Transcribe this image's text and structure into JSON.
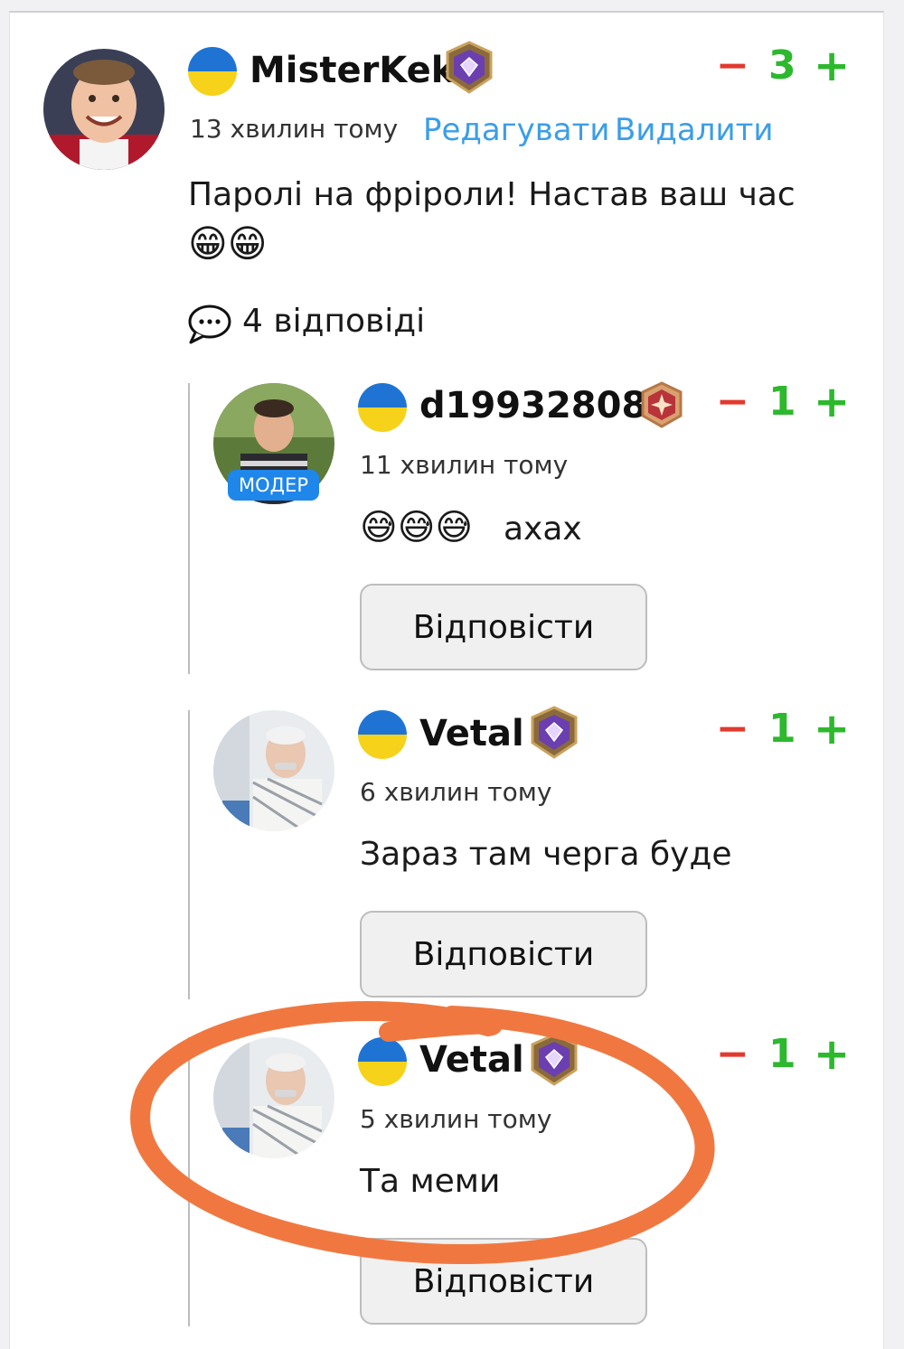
{
  "comment": {
    "username": "MisterKek",
    "time": "13 хвилин тому",
    "edit_label": "Редагувати",
    "delete_label": "Видалити",
    "text": "Паролі на фріроли! Настав ваш час",
    "emojis": "😁😁",
    "score": "3",
    "minus": "−",
    "plus": "+",
    "replies_count_label": "4 відповіді"
  },
  "replies": [
    {
      "username": "d19932808",
      "badge": "МОДЕР",
      "time": "11 хвилин тому",
      "emojis": "😅😅😅",
      "text": "ахах",
      "score": "1",
      "reply_label": "Відповісти"
    },
    {
      "username": "Vetal",
      "time": "6 хвилин тому",
      "text": "Зараз там черга буде",
      "score": "1",
      "reply_label": "Відповісти"
    },
    {
      "username": "Vetal",
      "time": "5 хвилин тому",
      "text": "Та меми",
      "score": "1",
      "reply_label": "Відповісти"
    }
  ],
  "colors": {
    "minus": "#e23a2e",
    "plus": "#2db82d",
    "link": "#3a9ee8",
    "flag_blue": "#1f74d3",
    "flag_yellow": "#f6d21a",
    "annotation": "#f07840"
  }
}
